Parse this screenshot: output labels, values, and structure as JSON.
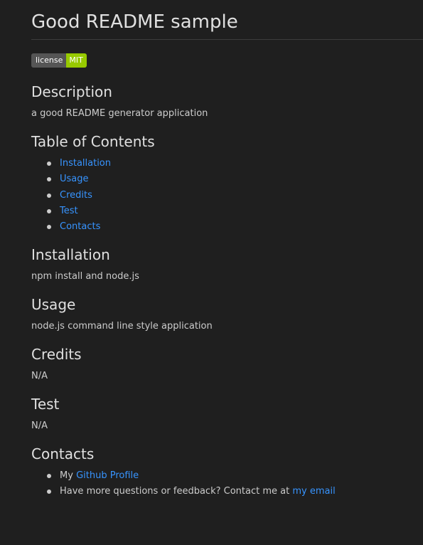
{
  "title": "Good README sample",
  "badge": {
    "label": "license",
    "value": "MIT",
    "label_color": "#555555",
    "value_color": "#97ca00"
  },
  "description": {
    "heading": "Description",
    "text": "a good README generator application"
  },
  "toc": {
    "heading": "Table of Contents",
    "items": [
      "Installation",
      "Usage",
      "Credits",
      "Test",
      "Contacts"
    ]
  },
  "installation": {
    "heading": "Installation",
    "text": "npm install and node.js"
  },
  "usage": {
    "heading": "Usage",
    "text": "node.js command line style application"
  },
  "credits": {
    "heading": "Credits",
    "text": "N/A"
  },
  "test": {
    "heading": "Test",
    "text": "N/A"
  },
  "contacts": {
    "heading": "Contacts",
    "github_prefix": "My",
    "github_link": "Github Profile",
    "email_prefix": "Have more questions or feedback? Contact me at",
    "email_link": "my email"
  },
  "colors": {
    "background": "#1f1f1f",
    "text": "#cccccc",
    "heading": "#e0e0e0",
    "link": "#3794ff"
  }
}
